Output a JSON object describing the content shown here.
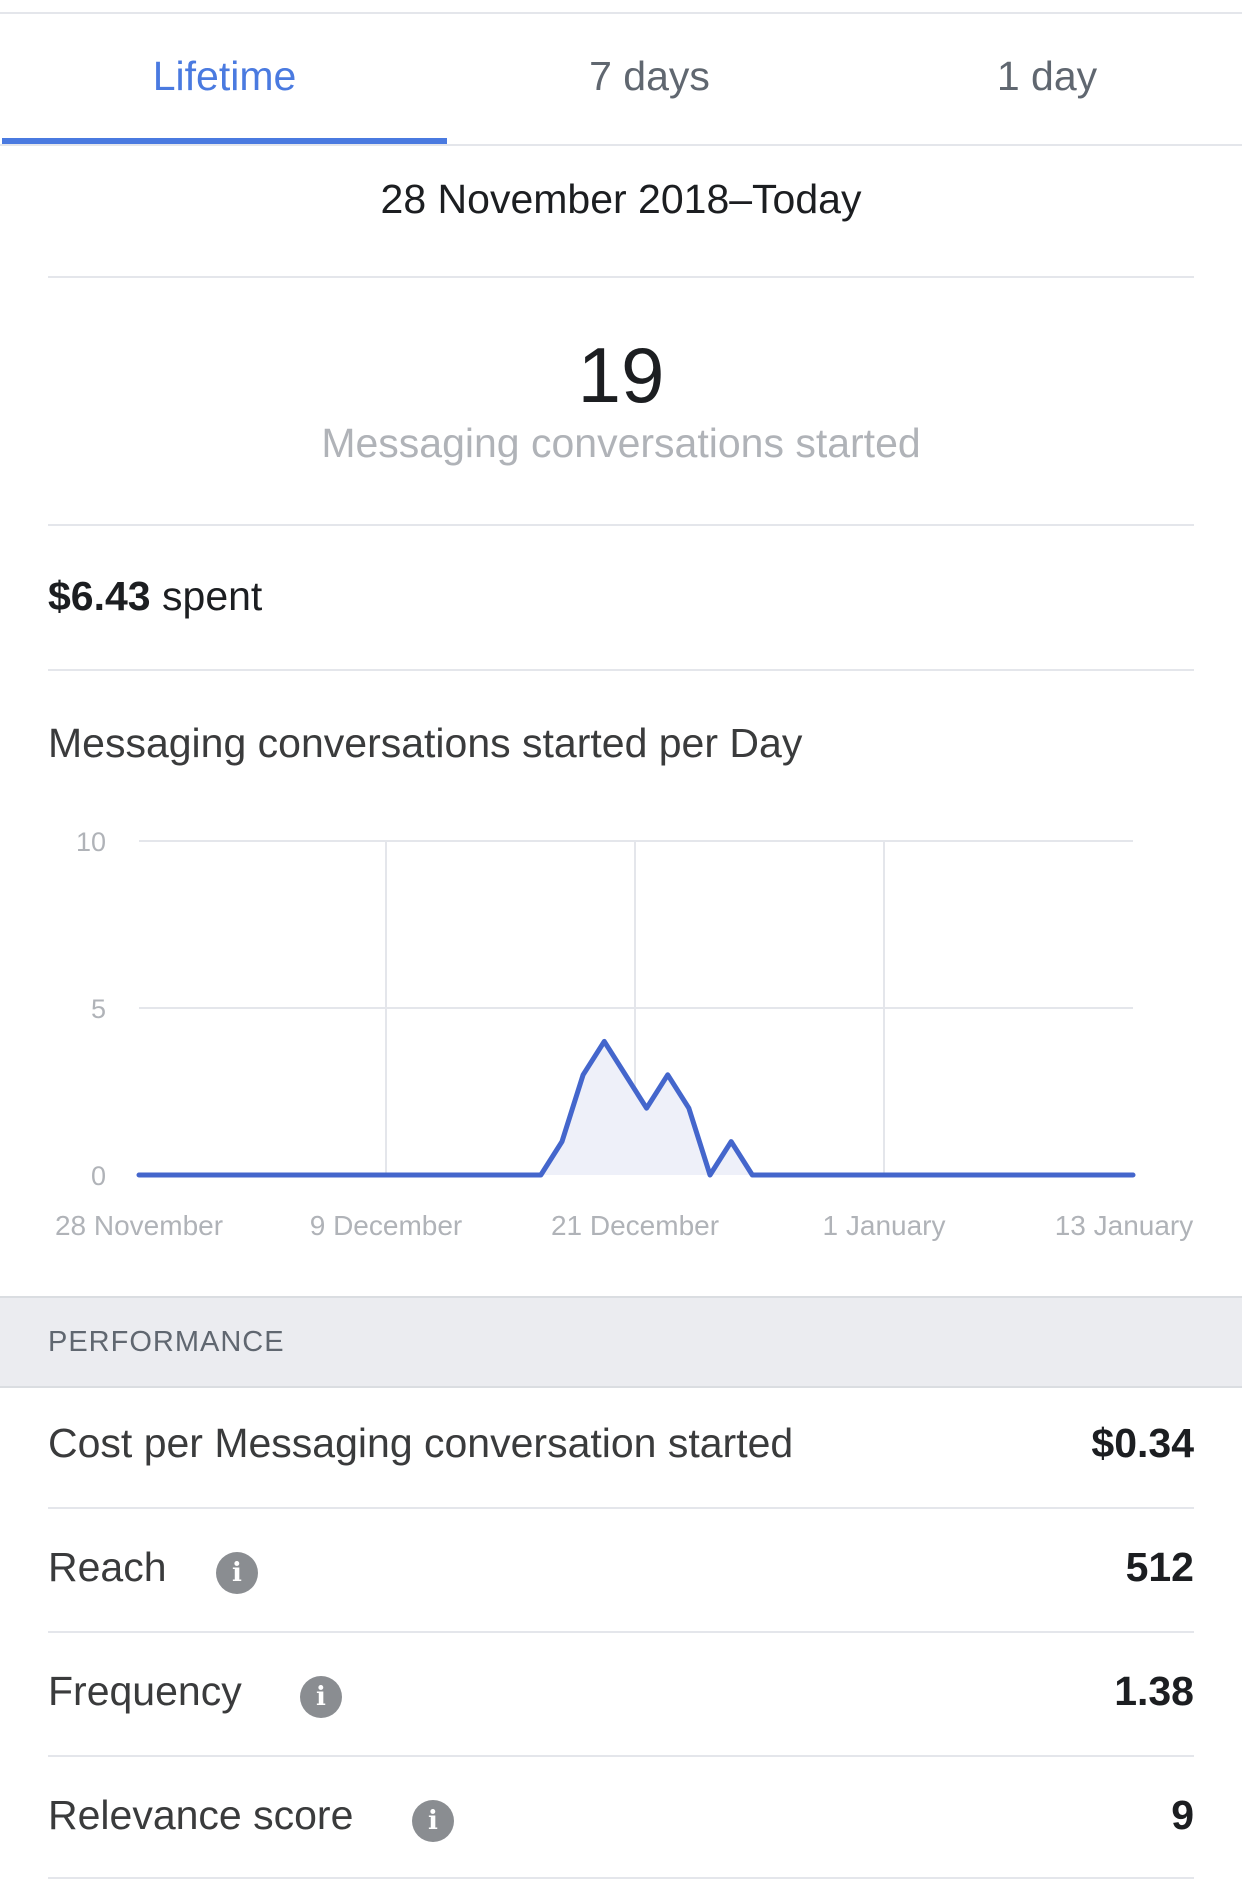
{
  "tabs": [
    {
      "label": "Lifetime",
      "active": true
    },
    {
      "label": "7 days",
      "active": false
    },
    {
      "label": "1 day",
      "active": false
    }
  ],
  "date_range": "28 November 2018–Today",
  "summary": {
    "value": "19",
    "label": "Messaging conversations started"
  },
  "spent": {
    "amount": "$6.43",
    "suffix": "spent"
  },
  "chart_data": {
    "type": "line",
    "title": "Messaging conversations started per Day",
    "y_ticks": [
      "10",
      "5",
      "0"
    ],
    "x_tick_labels": [
      "28 November",
      "9 December",
      "21 December",
      "1 January",
      "13 January"
    ],
    "ylim": [
      0,
      10
    ],
    "grid": true,
    "series": [
      {
        "values": [
          0,
          0,
          0,
          0,
          0,
          0,
          0,
          0,
          0,
          0,
          0,
          0,
          0,
          0,
          0,
          0,
          0,
          0,
          0,
          0,
          1,
          3,
          4,
          3,
          2,
          3,
          2,
          0,
          1,
          0,
          0,
          0,
          0,
          0,
          0,
          0,
          0,
          0,
          0,
          0,
          0,
          0,
          0,
          0,
          0,
          0,
          0,
          0
        ]
      }
    ],
    "colors": {
      "line": "#4466cc",
      "fill": "#eef0f9"
    }
  },
  "performance": {
    "header": "PERFORMANCE",
    "rows": [
      {
        "label": "Cost per Messaging conversation started",
        "value": "$0.34",
        "info": false
      },
      {
        "label": "Reach",
        "value": "512",
        "info": true
      },
      {
        "label": "Frequency",
        "value": "1.38",
        "info": true
      },
      {
        "label": "Relevance score",
        "value": "9",
        "info": true
      }
    ],
    "info_glyph": "i"
  },
  "colors": {
    "accent": "#4a7ae0",
    "muted_text": "#b0b3b8",
    "section_bg": "#ebecf0"
  }
}
